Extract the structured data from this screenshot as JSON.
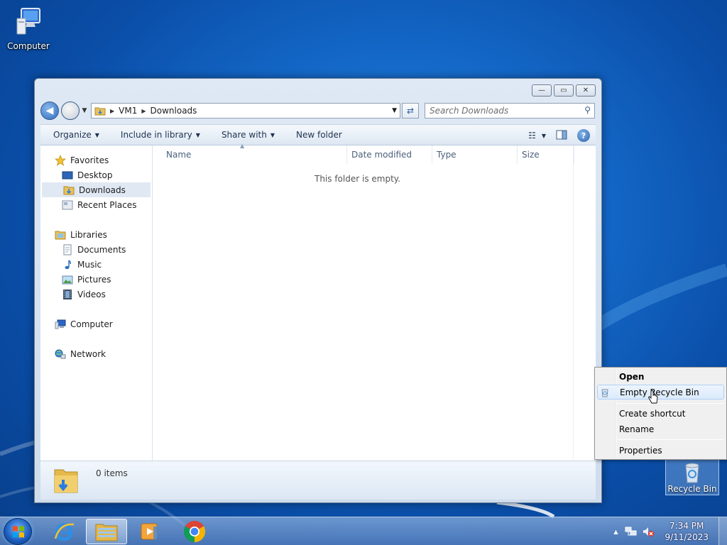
{
  "desktop": {
    "computer_label": "Computer",
    "recycle_label": "Recycle Bin"
  },
  "window": {
    "caption_buttons": {
      "minimize": "—",
      "maximize": "▭",
      "close": "✕"
    },
    "address": {
      "crumbs": [
        "VM1",
        "Downloads"
      ]
    },
    "search_placeholder": "Search Downloads",
    "toolbar": {
      "organize": "Organize",
      "include_in_library": "Include in library",
      "share_with": "Share with",
      "new_folder": "New folder"
    },
    "navpane": {
      "favorites": "Favorites",
      "desktop": "Desktop",
      "downloads": "Downloads",
      "recent_places": "Recent Places",
      "libraries": "Libraries",
      "documents": "Documents",
      "music": "Music",
      "pictures": "Pictures",
      "videos": "Videos",
      "computer": "Computer",
      "network": "Network"
    },
    "columns": [
      "Name",
      "Date modified",
      "Type",
      "Size"
    ],
    "empty_message": "This folder is empty.",
    "details": {
      "item_count": "0 items"
    }
  },
  "context_menu": {
    "items": [
      "Open",
      "Empty Recycle Bin",
      "Create shortcut",
      "Rename",
      "Properties"
    ]
  },
  "taskbar": {
    "time": "7:34 PM",
    "date": "9/11/2023"
  },
  "colors": {
    "wallpaper": "#1468c8",
    "menu_highlight": "#dbeafb",
    "nav_selected": "#e0e8f3"
  }
}
